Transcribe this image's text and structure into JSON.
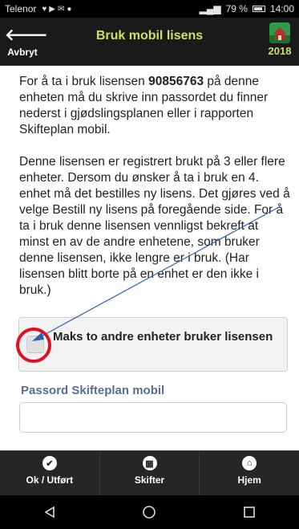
{
  "status_bar": {
    "carrier": "Telenor",
    "battery": "79 %",
    "time": "14:00"
  },
  "header": {
    "back_label": "Avbryt",
    "title": "Bruk mobil lisens",
    "logo_year": "2018"
  },
  "content": {
    "p1_pre": "For å ta i bruk lisensen ",
    "p1_license": "90856763",
    "p1_post": " på denne enheten må du skrive inn passordet du finner nederst i gjødslingsplanen eller i rapporten Skifteplan mobil.",
    "p2": "Denne lisensen er registrert brukt på 3 eller flere enheter. Dersom du ønsker å ta i bruk en 4. enhet må det bestilles ny lisens. Det gjøres ved å velge Bestill ny lisens på foregående side. For å ta i bruk denne lisensen vennligst bekreft at minst en av de andre enhetene, som bruker denne lisensen, ikke lengre er i bruk. (Har lisensen blitt borte på en enhet er den ikke i bruk.)"
  },
  "checkbox": {
    "label": "Maks to andre enheter bruker lisensen",
    "checked": false
  },
  "password": {
    "label": "Passord Skifteplan mobil",
    "value": ""
  },
  "tabs": [
    {
      "label": "Ok / Utført",
      "icon": "check-icon"
    },
    {
      "label": "Skifter",
      "icon": "grid-icon"
    },
    {
      "label": "Hjem",
      "icon": "home-icon"
    }
  ],
  "colors": {
    "header_title": "#cde35a",
    "field_label": "#5a6d98",
    "annotation_circle": "#e01020",
    "annotation_arrow": "#2f5fb0"
  }
}
